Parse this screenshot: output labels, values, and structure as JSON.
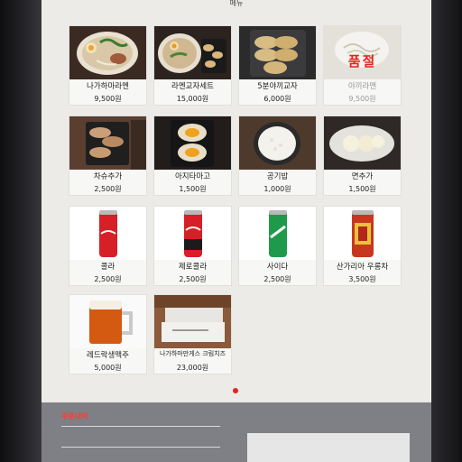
{
  "header": {
    "title": "메뉴"
  },
  "menu": [
    {
      "name": "나가하마라멘",
      "price": "9,500원",
      "image": "ramen-bowl"
    },
    {
      "name": "라멘교자세트",
      "price": "15,000원",
      "image": "ramen-gyoza-set"
    },
    {
      "name": "5분야끼교자",
      "price": "6,000원",
      "image": "gyoza-plate"
    },
    {
      "name": "야끼라멘",
      "price": "9,500원",
      "image": "yaki-ramen",
      "sold_out_label": "품절"
    },
    {
      "name": "차슈추가",
      "price": "2,500원",
      "image": "chashu-pork"
    },
    {
      "name": "아지타마고",
      "price": "1,500원",
      "image": "ajitama-egg"
    },
    {
      "name": "공기밥",
      "price": "1,000원",
      "image": "rice-bowl"
    },
    {
      "name": "면추가",
      "price": "1,500원",
      "image": "noodle-balls"
    },
    {
      "name": "콜라",
      "price": "2,500원",
      "image": "coca-cola-can"
    },
    {
      "name": "제로콜라",
      "price": "2,500원",
      "image": "zero-cola-can"
    },
    {
      "name": "사이다",
      "price": "2,500원",
      "image": "chilsung-cider-can"
    },
    {
      "name": "산가리아 우롱차",
      "price": "3,500원",
      "image": "oolong-tea-can"
    },
    {
      "name": "레드락생맥주",
      "price": "5,000원",
      "image": "draft-beer-mug"
    },
    {
      "name": "나가하마만게스 크림치즈",
      "price": "23,000원",
      "image": "cream-cheese-box"
    }
  ],
  "cart": {
    "title": "주문내역"
  },
  "colors": {
    "accent": "#e3241b",
    "screen": "#ecebe7",
    "cart_bg": "#7f8085"
  }
}
